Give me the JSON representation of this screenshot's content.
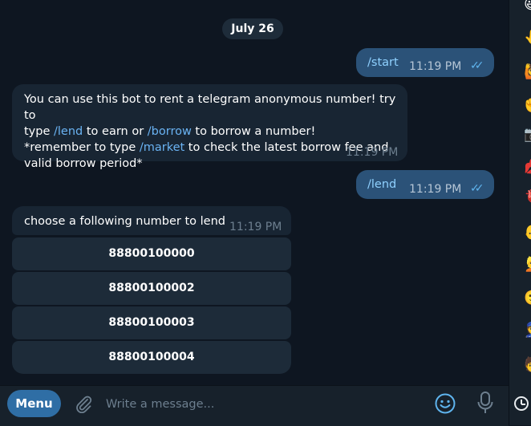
{
  "date_label": "July 26",
  "messages": [
    {
      "text": "/start",
      "time": "11:19 PM"
    },
    {
      "time": "11:19 PM",
      "line1a": "You can use this bot to rent a telegram anonymous number! try to",
      "line2a": "type ",
      "line2b": "/lend",
      "line2c": " to earn or ",
      "line2d": "/borrow",
      "line2e": " to borrow a number!",
      "line3a": "*remember to type ",
      "line3b": "/market",
      "line3c": " to check the latest borrow fee and",
      "line4a": "valid borrow period*"
    },
    {
      "text": "/lend",
      "time": "11:19 PM"
    },
    {
      "text": "choose a following number to lend",
      "time": "11:19 PM"
    }
  ],
  "keyboard": [
    "88800100000",
    "88800100002",
    "88800100003",
    "88800100004"
  ],
  "composer": {
    "menu_label": "Menu",
    "placeholder": "Write a message..."
  },
  "colors": {
    "background": "#0e1621",
    "outgoing": "#2b5278",
    "incoming": "#182533",
    "accent": "#6ab3f3",
    "menu": "#2f6ea5"
  },
  "icons": [
    "attach-icon",
    "emoji-icon",
    "mic-icon",
    "read-ticks-icon",
    "clock-icon"
  ]
}
